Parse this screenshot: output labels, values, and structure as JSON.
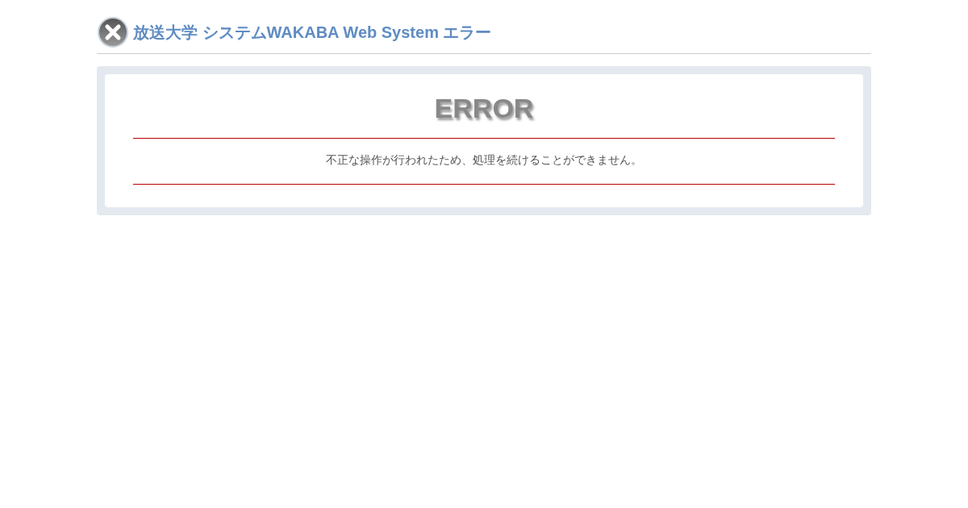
{
  "header": {
    "title": "放送大学 システムWAKABA Web System エラー"
  },
  "error": {
    "heading": "ERROR",
    "message": "不正な操作が行われたため、処理を続けることができません。"
  }
}
